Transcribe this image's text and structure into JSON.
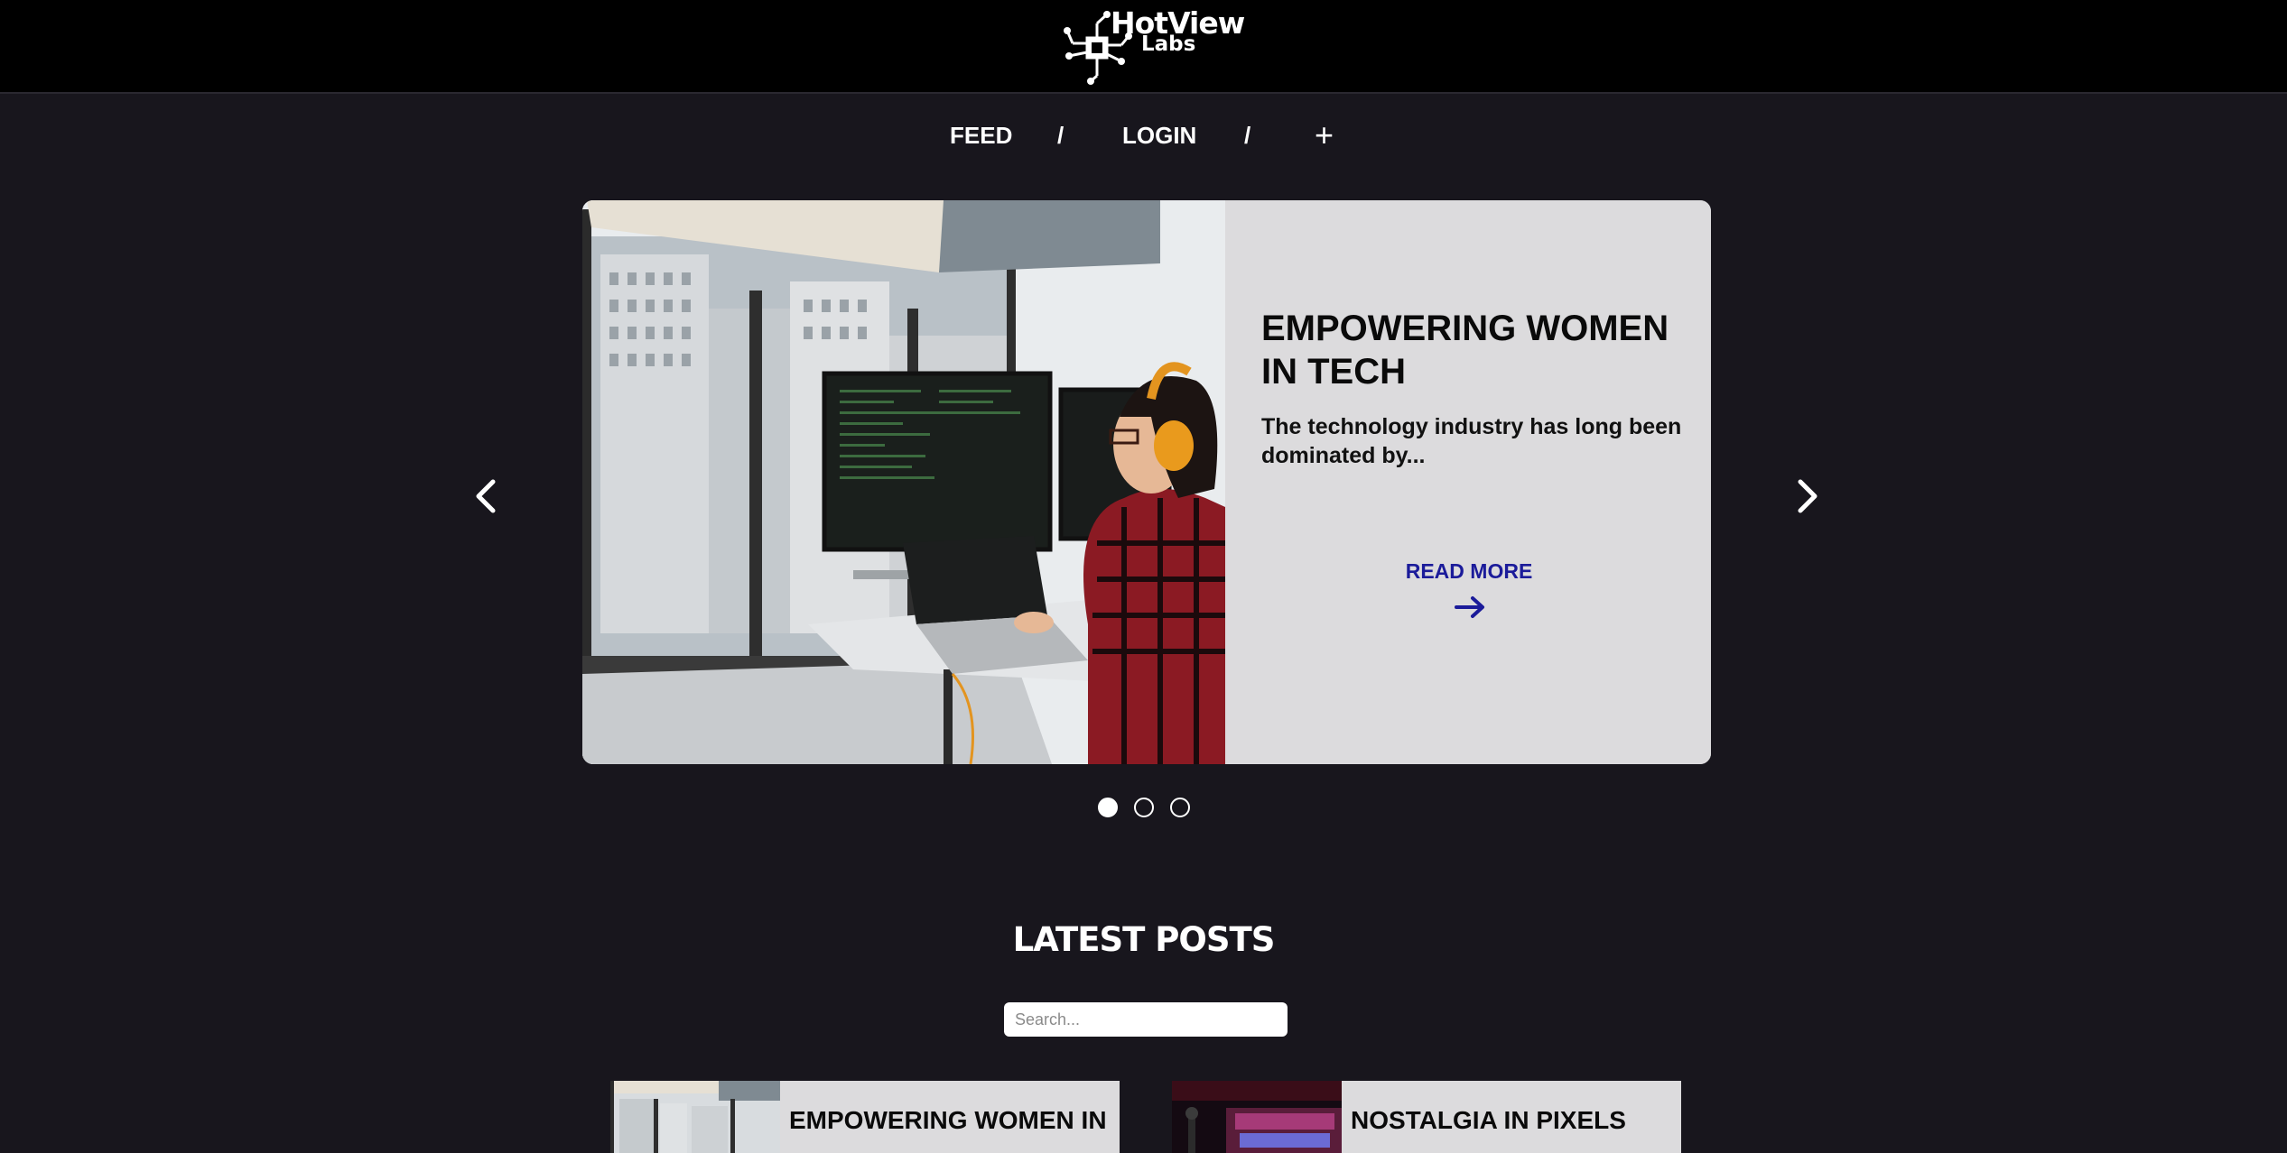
{
  "header": {
    "logo_line1": "HotView",
    "logo_line2": "Labs"
  },
  "nav": {
    "feed": "FEED",
    "sep1": "/",
    "login": "LOGIN",
    "sep2": "/",
    "add": "+"
  },
  "carousel": {
    "title": "EMPOWERING WOMEN IN TECH",
    "excerpt": "The technology industry has long been dominated by...",
    "read_more": "READ MORE",
    "active_index": 0,
    "slide_count": 3
  },
  "latest": {
    "heading": "LATEST POSTS",
    "search_placeholder": "Search...",
    "posts": [
      {
        "title": "EMPOWERING WOMEN IN"
      },
      {
        "title": "NOSTALGIA IN PIXELS"
      }
    ]
  },
  "colors": {
    "page_bg": "#18161d",
    "header_bg": "#000000",
    "card_bg": "#dcdbdd",
    "link": "#1b1b9a"
  }
}
